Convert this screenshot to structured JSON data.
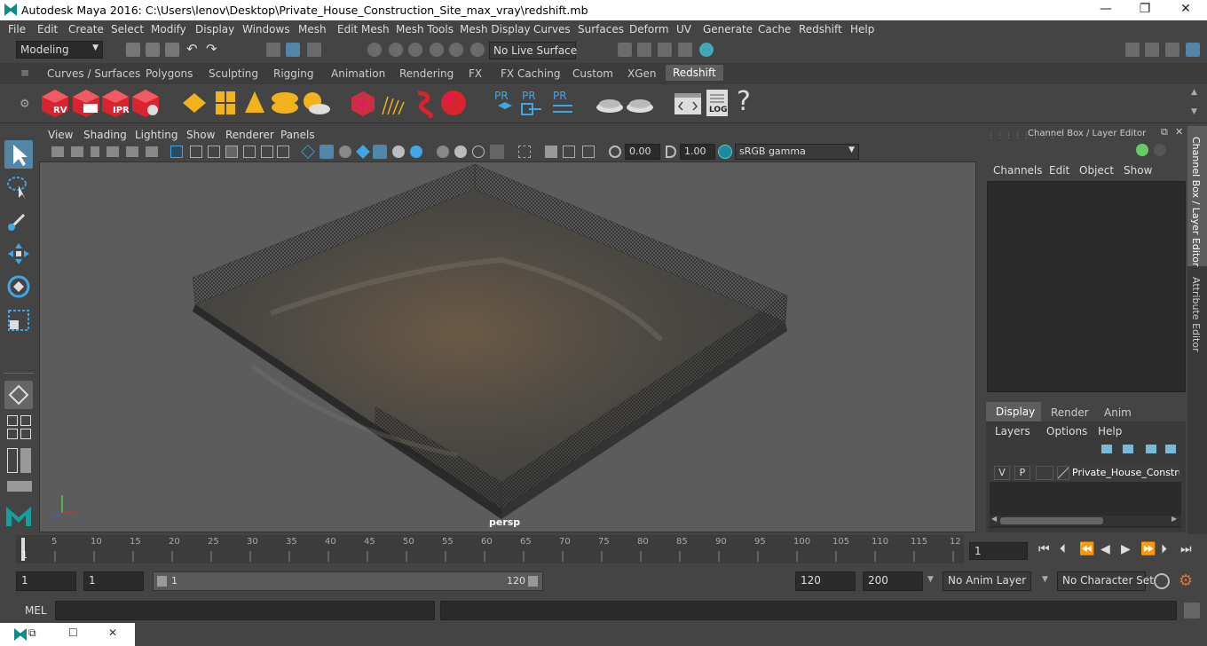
{
  "window": {
    "title": "Autodesk Maya 2016: C:\\Users\\lenov\\Desktop\\Private_House_Construction_Site_max_vray\\redshift.mb",
    "min": "—",
    "max": "❐",
    "close": "✕"
  },
  "menu": [
    "File",
    "Edit",
    "Create",
    "Select",
    "Modify",
    "Display",
    "Windows",
    "Mesh",
    "Edit Mesh",
    "Mesh Tools",
    "Mesh Display",
    "Curves",
    "Surfaces",
    "Deform",
    "UV",
    "Generate",
    "Cache",
    "Redshift",
    "Help"
  ],
  "status": {
    "mode": "Modeling",
    "live_surface": "No Live Surface"
  },
  "shelf_tabs": [
    "Curves / Surfaces",
    "Polygons",
    "Sculpting",
    "Rigging",
    "Animation",
    "Rendering",
    "FX",
    "FX Caching",
    "Custom",
    "XGen",
    "Redshift"
  ],
  "shelf": {
    "rv": "RV",
    "ipr": "IPR",
    "pr": "PR",
    "log": "LOG",
    "help": "?"
  },
  "viewport": {
    "menus": [
      "View",
      "Shading",
      "Lighting",
      "Show",
      "Renderer",
      "Panels"
    ],
    "exposure": "0.00",
    "gamma": "1.00",
    "colorspace": "sRGB gamma",
    "camera": "persp"
  },
  "channel_box": {
    "title": "Channel Box / Layer Editor",
    "menus": [
      "Channels",
      "Edit",
      "Object",
      "Show"
    ]
  },
  "layer_editor": {
    "tabs": [
      "Display",
      "Render",
      "Anim"
    ],
    "menus": [
      "Layers",
      "Options",
      "Help"
    ],
    "layer": {
      "v": "V",
      "p": "P",
      "name": "Private_House_Construct"
    }
  },
  "side_tabs": [
    "Channel Box / Layer Editor",
    "Attribute Editor"
  ],
  "timeline": {
    "ticks": [
      "5",
      "10",
      "15",
      "20",
      "25",
      "30",
      "35",
      "40",
      "45",
      "50",
      "55",
      "60",
      "65",
      "70",
      "75",
      "80",
      "85",
      "90",
      "95",
      "100",
      "105",
      "110",
      "115",
      "12"
    ],
    "start_label": "1",
    "current": "1"
  },
  "range": {
    "start": "1",
    "start2": "1",
    "slider_start": "1",
    "slider_end": "120",
    "end": "120",
    "max": "200",
    "anim_layer": "No Anim Layer",
    "char_set": "No Character Set"
  },
  "cmd": {
    "label": "MEL"
  },
  "colors": {
    "accent": "#5d5d5d",
    "redshift_red": "#d9232e",
    "highlight": "#5285a6"
  }
}
